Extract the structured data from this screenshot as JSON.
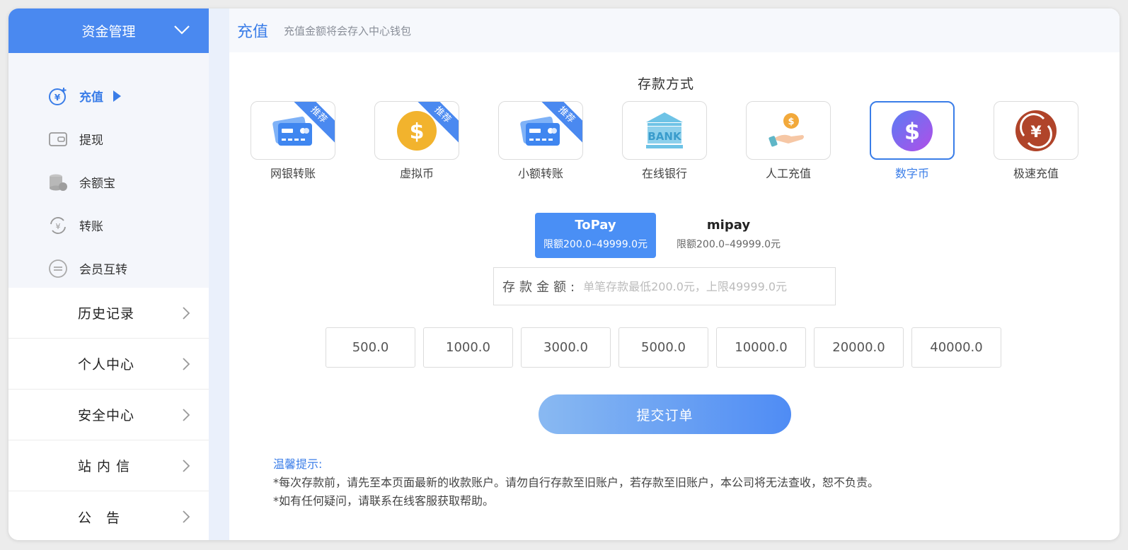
{
  "sidebar": {
    "header": "资金管理",
    "sub_items": [
      {
        "label": "充值",
        "icon": "recharge-yuan-icon",
        "active": true
      },
      {
        "label": "提现",
        "icon": "wallet-icon"
      },
      {
        "label": "余额宝",
        "icon": "coin-stack-icon"
      },
      {
        "label": "转账",
        "icon": "transfer-yuan-icon"
      },
      {
        "label": "会员互转",
        "icon": "exchange-icon"
      }
    ],
    "items": [
      {
        "label": "历史记录"
      },
      {
        "label": "个人中心"
      },
      {
        "label": "安全中心"
      },
      {
        "label": "站 内 信"
      },
      {
        "label": "公　告"
      }
    ]
  },
  "topbar": {
    "title": "充值",
    "subtitle": "充值金额将会存入中心钱包"
  },
  "deposit": {
    "section_title": "存款方式",
    "methods": [
      {
        "label": "网银转账",
        "icon": "bank-card-icon",
        "badge": "推荐"
      },
      {
        "label": "虚拟币",
        "icon": "dollar-coin-icon",
        "badge": "推荐"
      },
      {
        "label": "小额转账",
        "icon": "bank-card-icon",
        "badge": "推荐"
      },
      {
        "label": "在线银行",
        "icon": "bank-building-icon",
        "bank_text": "BANK"
      },
      {
        "label": "人工充值",
        "icon": "hand-coin-icon"
      },
      {
        "label": "数字币",
        "icon": "digital-dollar-icon",
        "active": true
      },
      {
        "label": "极速充值",
        "icon": "fast-yuan-icon"
      }
    ],
    "channels": [
      {
        "name": "ToPay",
        "limit": "限额200.0–49999.0元",
        "active": true
      },
      {
        "name": "mipay",
        "limit": "限额200.0–49999.0元"
      }
    ],
    "amount_label": "存款金额:",
    "amount_placeholder": "单笔存款最低200.0元，上限49999.0元",
    "quick_amounts": [
      "500.0",
      "1000.0",
      "3000.0",
      "5000.0",
      "10000.0",
      "20000.0",
      "40000.0"
    ],
    "submit_label": "提交订单"
  },
  "tips": {
    "heading": "温馨提示:",
    "lines": [
      "*每次存款前，请先至本页面最新的收款账户。请勿自行存款至旧账户，若存款至旧账户，本公司将无法查收，恕不负责。",
      "*如有任何疑问，请联系在线客服获取帮助。"
    ]
  },
  "colors": {
    "accent": "#4a89f0",
    "accent_text": "#3a7de8"
  }
}
